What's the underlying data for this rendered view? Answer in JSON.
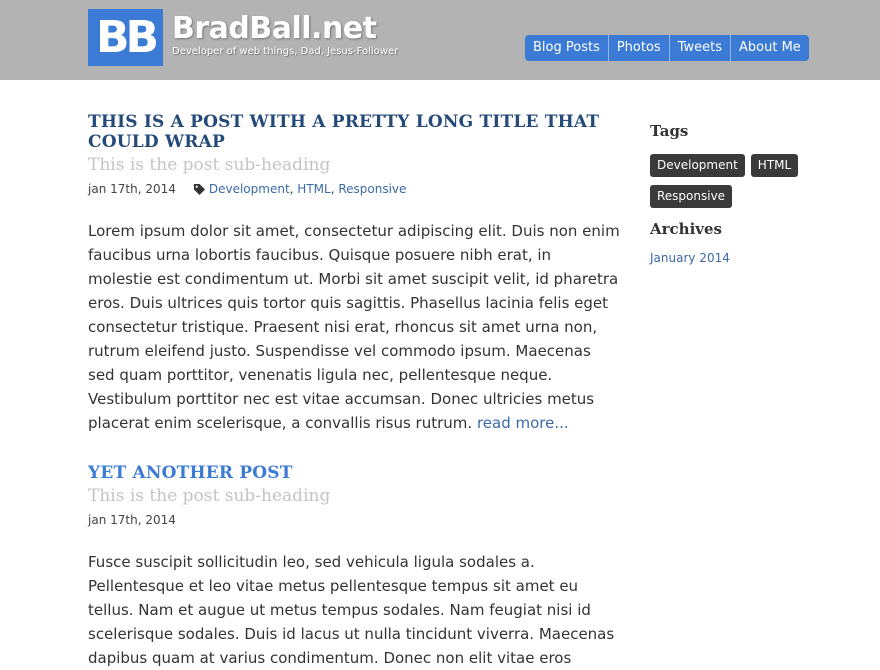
{
  "header": {
    "logo_text": "BB",
    "site_title": "BradBall.net",
    "tagline": "Developer of web things, Dad, Jesus-Follower",
    "nav": [
      "Blog Posts",
      "Photos",
      "Tweets",
      "About Me"
    ],
    "background_color": "#b3b3b3",
    "accent_color": "#3b7bd6"
  },
  "posts": [
    {
      "title": "This is a post with a pretty long title that could wrap",
      "subheading": "This is the post sub-heading",
      "date": "jan 17th, 2014",
      "tags": [
        "Development",
        "HTML",
        "Responsive"
      ],
      "tag_icon": "tag-icon",
      "body": "Lorem ipsum dolor sit amet, consectetur adipiscing elit. Duis non enim faucibus urna lobortis faucibus. Quisque posuere nibh erat, in molestie est condimentum ut. Morbi sit amet suscipit velit, id pharetra eros. Duis ultrices quis tortor quis sagittis. Phasellus lacinia felis eget consectetur tristique. Praesent nisi erat, rhoncus sit amet urna non, rutrum eleifend justo. Suspendisse vel commodo ipsum. Maecenas sed quam porttitor, venenatis ligula nec, pellentesque neque. Vestibulum porttitor nec est vitae accumsan. Donec ultricies metus placerat enim scelerisque, a convallis risus rutrum.",
      "read_more": "read more..."
    },
    {
      "title": "Yet another post",
      "subheading": "This is the post sub-heading",
      "date": "jan 17th, 2014",
      "body": "Fusce suscipit sollicitudin leo, sed vehicula ligula sodales a. Pellentesque et leo vitae metus pellentesque tempus sit amet eu tellus. Nam et augue ut metus tempus sodales. Nam feugiat nisi id scelerisque sodales. Duis id lacus ut nulla tincidunt viverra. Maecenas dapibus quam at varius condimentum. Donec non elit vitae eros"
    }
  ],
  "sidebar": {
    "tags_heading": "Tags",
    "tags": [
      "Development",
      "HTML",
      "Responsive"
    ],
    "archives_heading": "Archives",
    "archives": [
      "January 2014"
    ]
  }
}
